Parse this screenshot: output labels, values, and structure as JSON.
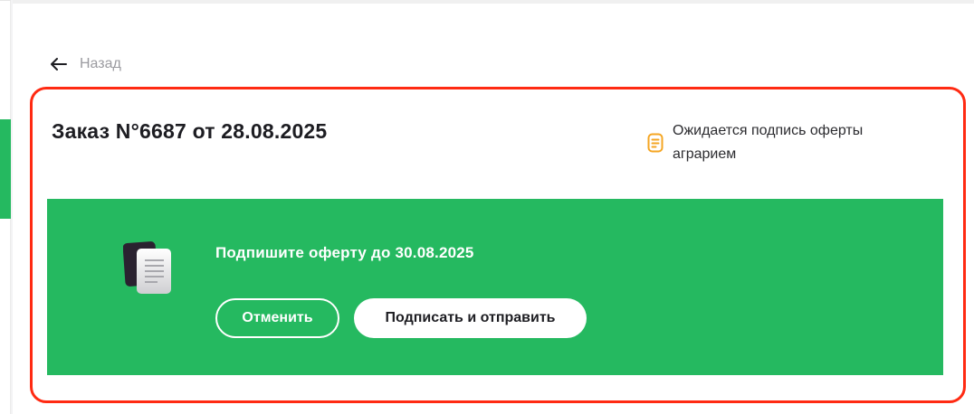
{
  "nav": {
    "back_label": "Назад",
    "back_icon": "arrow-left-icon"
  },
  "order": {
    "title": "Заказ N°6687 от 28.08.2025",
    "status_text": "Ожидается подпись оферты аграрием",
    "status_icon": "document-list-icon",
    "status_color": "#f5a623"
  },
  "banner": {
    "message": "Подпишите оферту до 30.08.2025",
    "icon": "documents-icon",
    "cancel_label": "Отменить",
    "sign_label": "Подписать и отправить",
    "background": "#25b960"
  },
  "colors": {
    "highlight_border": "#ff2a12",
    "accent": "#25b960"
  }
}
